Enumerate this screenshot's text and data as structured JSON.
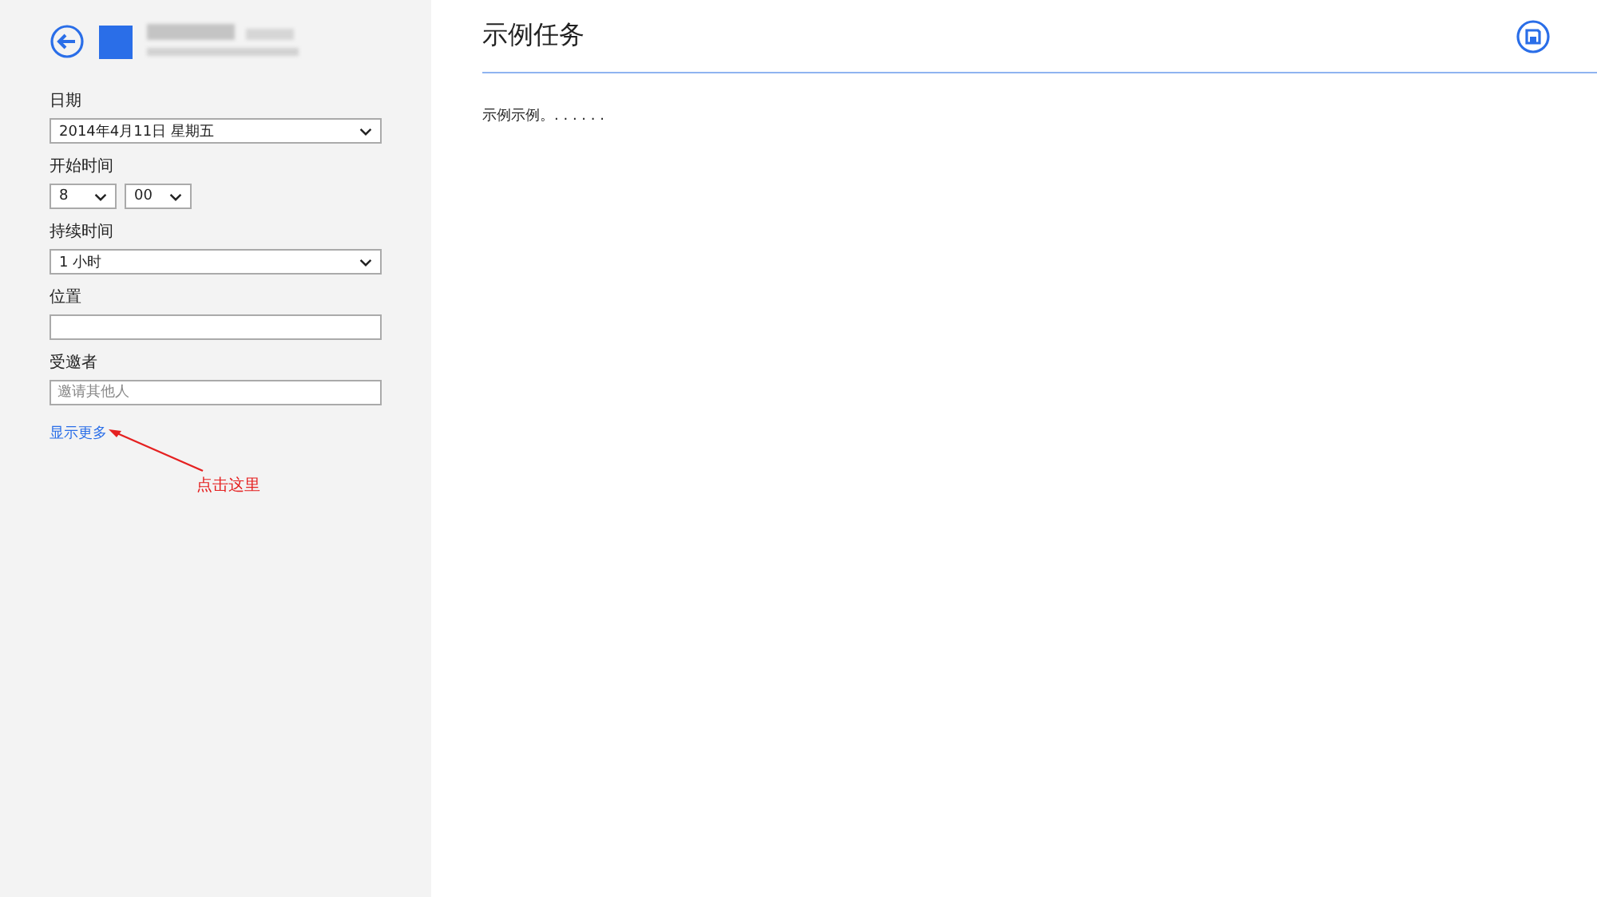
{
  "sidebar": {
    "fields": [
      {
        "kind": "dropdown",
        "label": "日期",
        "value": "2014年4月11日 星期五"
      },
      {
        "kind": "time",
        "label": "开始时间",
        "parts": [
          "8",
          "00"
        ]
      },
      {
        "kind": "dropdown",
        "label": "持续时间",
        "value": "1 小时"
      },
      {
        "kind": "text",
        "label": "位置"
      },
      {
        "kind": "text",
        "label": "受邀者",
        "placeholder": "邀请其他人"
      }
    ],
    "more_link": "显示更多"
  },
  "annotation": {
    "text": "点击这里"
  },
  "main": {
    "title": "示例任务",
    "body": "示例示例。. . . . . ."
  }
}
